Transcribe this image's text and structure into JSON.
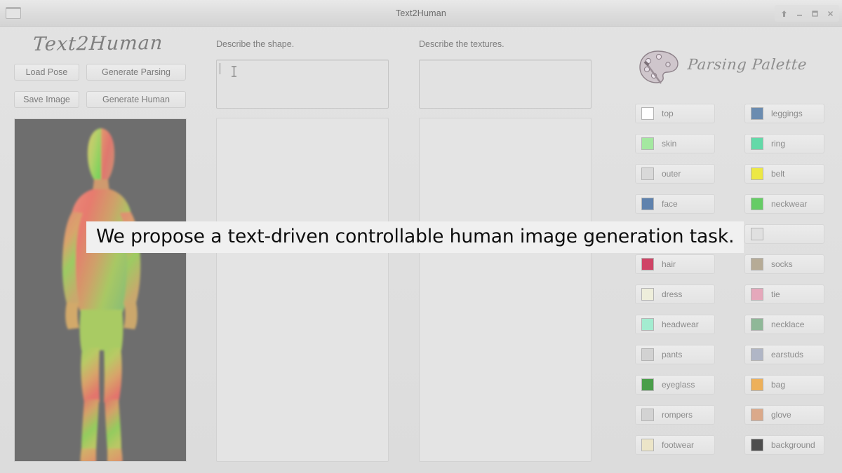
{
  "window": {
    "title": "Text2Human",
    "app_icon": "window-icon",
    "controls": [
      {
        "name": "pin-button",
        "glyph": "pin-icon"
      },
      {
        "name": "minimize-button",
        "glyph": "minimize-icon"
      },
      {
        "name": "maximize-button",
        "glyph": "maximize-icon"
      },
      {
        "name": "close-button",
        "glyph": "close-icon"
      }
    ]
  },
  "left": {
    "brand": "Text2Human",
    "buttons": {
      "load_pose": "Load Pose",
      "generate_parsing": "Generate Parsing",
      "save_image": "Save Image",
      "generate_human": "Generate Human"
    },
    "pose_preview": {
      "name": "pose-densepose-preview",
      "background": "#6e6e6e",
      "description": "DensePose UV map of a standing human figure"
    }
  },
  "shape": {
    "label": "Describe the shape.",
    "input_value": "",
    "input_placeholder": "",
    "focused": true,
    "result_panel": ""
  },
  "textures": {
    "label": "Describe the textures.",
    "input_value": "",
    "input_placeholder": "",
    "focused": false,
    "result_panel": ""
  },
  "palette": {
    "title": "Parsing Palette",
    "icon": "palette-icon",
    "rows": [
      [
        {
          "label": "top",
          "color": "#ffffff"
        },
        {
          "label": "leggings",
          "color": "#6b8cb0"
        }
      ],
      [
        {
          "label": "skin",
          "color": "#a4e8a0"
        },
        {
          "label": "ring",
          "color": "#63d9a8"
        }
      ],
      [
        {
          "label": "outer",
          "color": "#d9d9d9"
        },
        {
          "label": "belt",
          "color": "#ece845"
        }
      ],
      [
        {
          "label": "face",
          "color": "#5f82ad"
        },
        {
          "label": "neckwear",
          "color": "#66cc66"
        }
      ],
      [
        {
          "label": "",
          "color": "#e0e0e0"
        },
        {
          "label": "",
          "color": "#e0e0e0"
        }
      ],
      [
        {
          "label": "hair",
          "color": "#cf4466"
        },
        {
          "label": "socks",
          "color": "#b6ab96"
        }
      ],
      [
        {
          "label": "dress",
          "color": "#eeeedb"
        },
        {
          "label": "tie",
          "color": "#e5a8bb"
        }
      ],
      [
        {
          "label": "headwear",
          "color": "#a3ecd0"
        },
        {
          "label": "necklace",
          "color": "#8fb898"
        }
      ],
      [
        {
          "label": "pants",
          "color": "#d2d2d2"
        },
        {
          "label": "earstuds",
          "color": "#b0b6c6"
        }
      ],
      [
        {
          "label": "eyeglass",
          "color": "#4a9e4a"
        },
        {
          "label": "bag",
          "color": "#edb05a"
        }
      ],
      [
        {
          "label": "rompers",
          "color": "#d3d3d3"
        },
        {
          "label": "glove",
          "color": "#dba98a"
        }
      ],
      [
        {
          "label": "footwear",
          "color": "#ece5c8"
        },
        {
          "label": "background",
          "color": "#4d4d4d"
        }
      ]
    ]
  },
  "caption": {
    "text": "We propose a text-driven controllable human image generation task.",
    "background": "#f0f0f0",
    "color": "#0d0d0d"
  }
}
